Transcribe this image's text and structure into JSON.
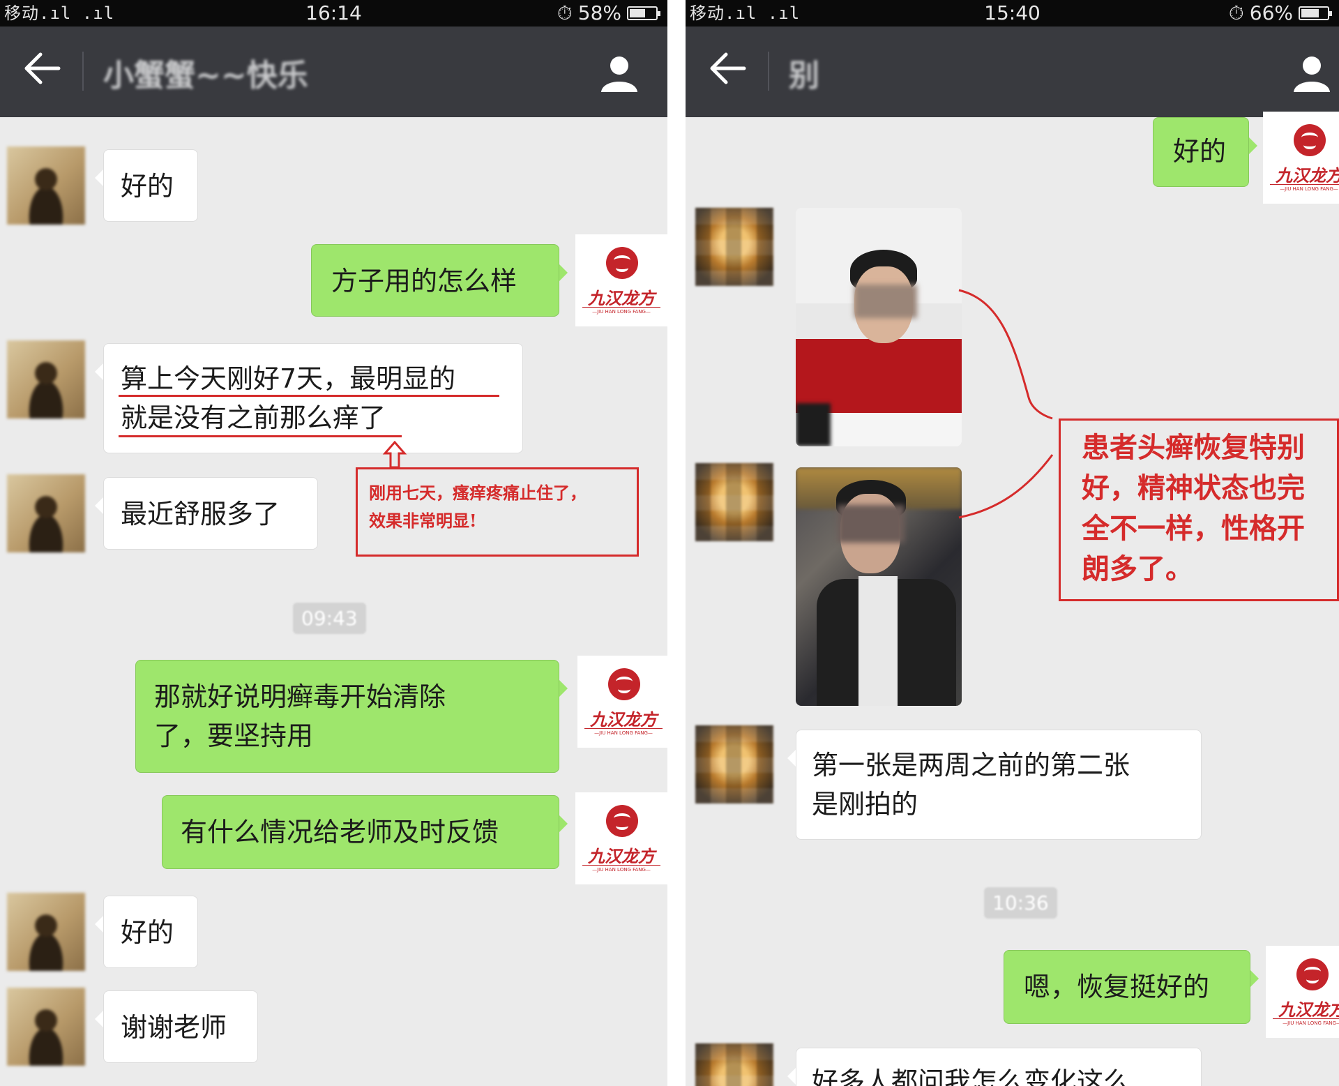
{
  "left_screen": {
    "status": {
      "signal": "移动.ıl .ıl",
      "time": "16:14",
      "alarm": "⏱",
      "battery": "58%",
      "battery_level": 0.58
    },
    "title": "小蟹蟹~~快乐",
    "timestamp": "09:43",
    "messages": [
      {
        "side": "in",
        "lines": [
          "好的"
        ]
      },
      {
        "side": "out",
        "lines": [
          "方子用的怎么样"
        ]
      },
      {
        "side": "in",
        "lines": [
          "算上今天刚好7天，最明显的",
          "就是没有之前那么痒了"
        ]
      },
      {
        "side": "in",
        "lines": [
          "最近舒服多了"
        ]
      },
      {
        "side": "out",
        "lines": [
          "那就好说明癣毒开始清除",
          "了，要坚持用"
        ]
      },
      {
        "side": "out",
        "lines": [
          "有什么情况给老师及时反馈"
        ]
      },
      {
        "side": "in",
        "lines": [
          "好的"
        ]
      },
      {
        "side": "in",
        "lines": [
          "谢谢老师"
        ]
      }
    ],
    "annotation": {
      "lines": [
        "刚用七天，瘙痒疼痛止住了，",
        "效果非常明显!"
      ]
    }
  },
  "right_screen": {
    "status": {
      "signal": "移动.ıl .ıl",
      "time": "15:40",
      "alarm": "⏱",
      "battery": "66%",
      "battery_level": 0.66
    },
    "title": "别",
    "timestamp": "10:36",
    "messages": [
      {
        "side": "out",
        "lines": [
          "好的"
        ]
      },
      {
        "side": "in",
        "lines": [
          "第一张是两周之前的第二张",
          "是刚拍的"
        ]
      },
      {
        "side": "out",
        "lines": [
          "嗯，恢复挺好的"
        ]
      },
      {
        "side": "in",
        "lines": [
          "好多人都问我怎么变化这么"
        ]
      }
    ],
    "annotation": {
      "lines": [
        "患者头癣恢复特别",
        "好，精神状态也完",
        "全不一样，性格开",
        "朗多了。"
      ]
    }
  },
  "brand": {
    "name": "九汉龙方",
    "pinyin": "—JIU HAN LONG FANG—"
  },
  "colors": {
    "outgoing_bubble": "#9ee66c",
    "incoming_bubble": "#ffffff",
    "chat_bg": "#ebebeb",
    "navbar": "#393a3f",
    "annotation": "#d52b2b",
    "logo": "#c4242a"
  }
}
